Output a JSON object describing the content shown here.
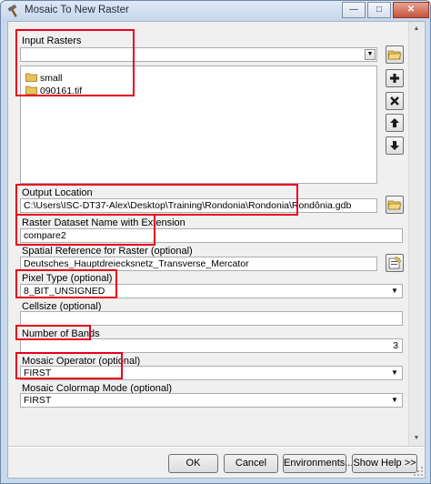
{
  "window": {
    "title": "Mosaic To New Raster",
    "minimize_label": "—",
    "maximize_label": "□",
    "close_label": "✕"
  },
  "input_rasters": {
    "label": "Input Rasters",
    "value": "",
    "items": [
      {
        "label": "small",
        "icon": "folder-icon"
      },
      {
        "label": "090161.tif",
        "icon": "folder-icon"
      }
    ],
    "side_buttons": [
      "add-icon",
      "remove-icon",
      "move-up-icon",
      "move-down-icon"
    ]
  },
  "output_location": {
    "label": "Output Location",
    "value": "C:\\Users\\ISC-DT37-Alex\\Desktop\\Training\\Rondonia\\Rondonia\\Rondônia.gdb"
  },
  "raster_dataset_name": {
    "label": "Raster Dataset Name with Extension",
    "value": "compare2"
  },
  "spatial_reference": {
    "label": "Spatial Reference for Raster (optional)",
    "value": "Deutsches_Hauptdreiecksnetz_Transverse_Mercator"
  },
  "pixel_type": {
    "label": "Pixel Type (optional)",
    "value": "8_BIT_UNSIGNED"
  },
  "cellsize": {
    "label": "Cellsize (optional)",
    "value": ""
  },
  "number_of_bands": {
    "label": "Number of Bands",
    "value": "3"
  },
  "mosaic_operator": {
    "label": "Mosaic Operator (optional)",
    "value": "FIRST"
  },
  "mosaic_colormap_mode": {
    "label": "Mosaic Colormap Mode (optional)",
    "value": "FIRST"
  },
  "buttons": {
    "ok": "OK",
    "cancel": "Cancel",
    "environments": "Environments...",
    "show_help": "Show Help >>"
  },
  "colors": {
    "highlight": "#e8001c",
    "window_frame": "#c9d9ec",
    "client_bg": "#f0f0f0",
    "folder": "#e8c25a"
  }
}
